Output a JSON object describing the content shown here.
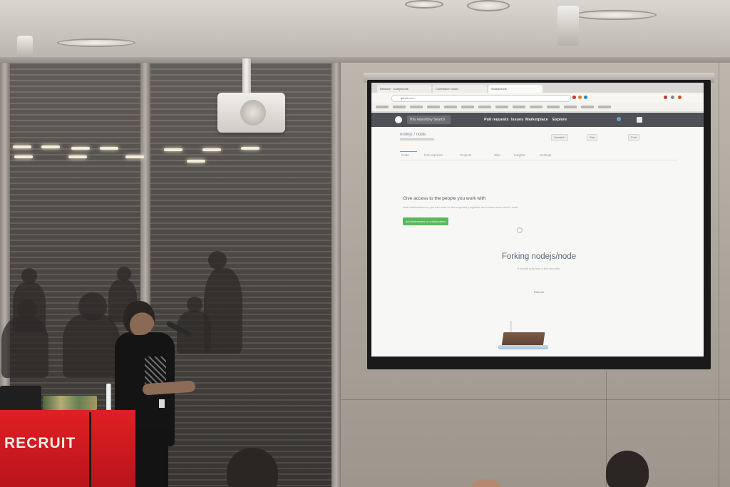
{
  "screen": {
    "browser": {
      "tabs": [
        "Network · nodejs/node",
        "Contributor Guide",
        "nodejs/node"
      ],
      "address": "github.com"
    },
    "github": {
      "header": {
        "repo_context": "This repository  Search",
        "nav": [
          "Pull requests",
          "Issues",
          "Marketplace",
          "Explore"
        ]
      },
      "repo_path": "nodejs / node",
      "repo_actions": [
        "Unwatch",
        "Star",
        "Fork"
      ],
      "repo_tabs": [
        "Code",
        "Pull requests",
        "Projects",
        "Wiki",
        "Insights",
        "Settings"
      ],
      "invite": {
        "title": "Give access to the people you work with",
        "text": "Add collaborators so you can work on this repository together and review each other's work.",
        "button": "Add teammates or collaborators"
      },
      "forking_title": "Forking nodejs/node",
      "forking_subtitle": "It should only take a few seconds.",
      "refresh_link": "Refresh"
    }
  },
  "podium": {
    "logo_text": "RECRUIT",
    "color": "#d81b20"
  }
}
